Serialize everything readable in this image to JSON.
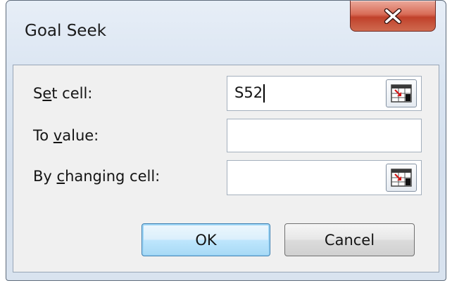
{
  "dialog": {
    "title": "Goal Seek",
    "close_label": "X"
  },
  "form": {
    "set_cell": {
      "label_pre": "S",
      "label_key": "e",
      "label_post": "t cell:",
      "value": "S52"
    },
    "to_value": {
      "label_pre": "To ",
      "label_key": "v",
      "label_post": "alue:",
      "value": ""
    },
    "changing_cell": {
      "label_pre": "By ",
      "label_key": "c",
      "label_post": "hanging cell:",
      "value": ""
    }
  },
  "buttons": {
    "ok": "OK",
    "cancel": "Cancel"
  },
  "icons": {
    "close": "close-icon",
    "collapse_dialog": "range-picker-icon"
  }
}
